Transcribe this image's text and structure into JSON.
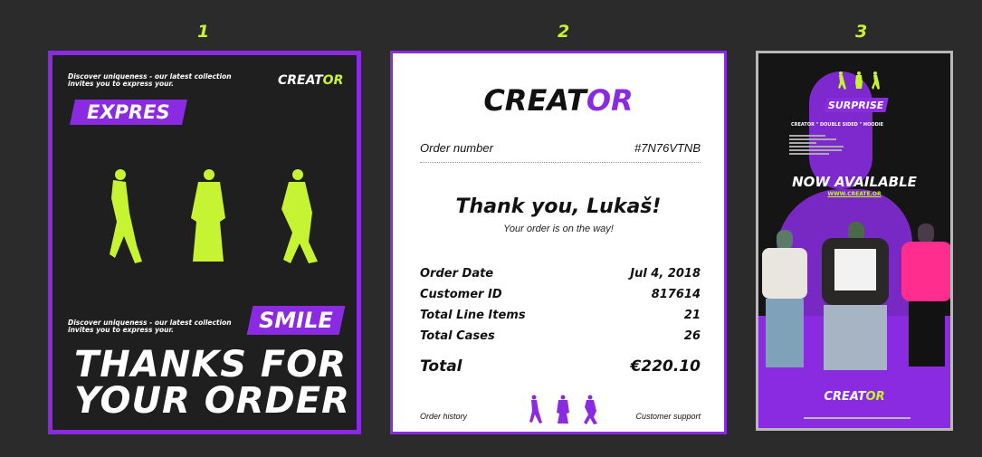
{
  "colors": {
    "accent_purple": "#8a2be2",
    "accent_lime": "#c6f432",
    "background": "#2b2b2b"
  },
  "numbers": [
    "1",
    "2",
    "3"
  ],
  "card1": {
    "tagline_top": "Discover uniqueness - our latest collection invites you to express your.",
    "logo_main": "CREAT",
    "logo_accent": "OR",
    "badge_top": "EXPRES",
    "tagline_bottom": "Discover uniqueness - our latest collection invites you to express your.",
    "badge_bottom": "SMILE",
    "headline_line1": "THANKS FOR",
    "headline_line2": "YOUR ORDER"
  },
  "card2": {
    "logo_main": "CREAT",
    "logo_accent": "OR",
    "order_number_label": "Order number",
    "order_number_value": "#7N76VTNB",
    "thank_you": "Thank you, Lukaš!",
    "subtitle": "Your order is on the way!",
    "details": [
      {
        "label": "Order Date",
        "value": "Jul 4, 2018"
      },
      {
        "label": "Customer ID",
        "value": "817614"
      },
      {
        "label": "Total Line Items",
        "value": "21"
      },
      {
        "label": "Total Cases",
        "value": "26"
      }
    ],
    "total_label": "Total",
    "total_value": "€220.10",
    "footer_left": "Order history",
    "footer_right": "Customer support"
  },
  "card3": {
    "badge": "SURPRISE",
    "product_title": "CREATOR \" DOUBLE SIDED \" HOODIE",
    "headline": "NOW AVAILABLE",
    "url": "WWW.CREATE.OR",
    "logo_main": "CREAT",
    "logo_accent": "OR"
  }
}
